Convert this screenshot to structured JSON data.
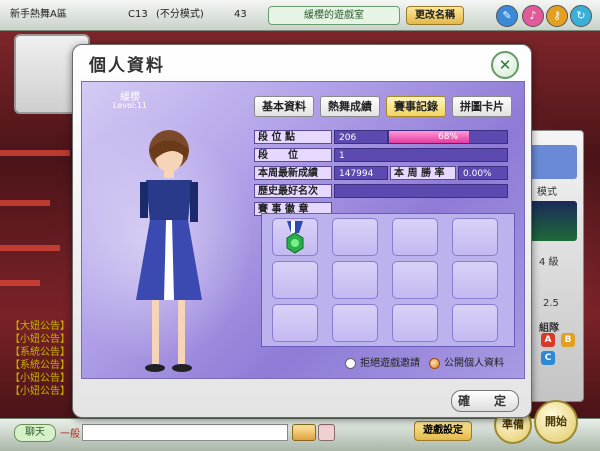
{
  "topbar": {
    "room_name": "新手熱舞A區",
    "room_number": "C13",
    "mode": "(不分模式)",
    "count": "43",
    "room_title": "緩櫻的遊戲室",
    "rename_label": "更改名稱"
  },
  "dialog": {
    "title": "個人資料",
    "character": {
      "name": "緩櫻",
      "level": "Level:11"
    },
    "tabs": [
      {
        "label": "基本資料",
        "active": false
      },
      {
        "label": "熱舞成績",
        "active": false
      },
      {
        "label": "賽事記錄",
        "active": true
      },
      {
        "label": "拼圖卡片",
        "active": false
      }
    ],
    "stats": {
      "rank_points_label": "段 位 點",
      "rank_points_value": "206",
      "rank_progress": 0.68,
      "rank_progress_label": "68%",
      "rank_label": "段　　位",
      "rank_value": "1",
      "weekly_best_label": "本周最新成績",
      "weekly_best_value": "147994",
      "weekly_win_rate_label": "本 周 勝 率",
      "weekly_win_rate_value": "0.00%",
      "best_rank_label": "歷史最好名次",
      "medals_label": "賽 事 徽 章"
    },
    "medal_slots": 12,
    "filled_medals": 1,
    "options": {
      "reject_invite_label": "拒絕遊戲邀請",
      "public_profile_label": "公開個人資料",
      "reject_invite_checked": false,
      "public_profile_checked": true
    },
    "ok_label": "確　定"
  },
  "bottombar": {
    "chat_label": "聊天",
    "chat_channel": "一般",
    "settings_label": "遊戲設定",
    "start_label": "開始",
    "ready_label": "準備"
  },
  "rightpanel": {
    "mode_label": "模式",
    "level_label": "4 級",
    "speed_value": "2.5",
    "team_label": "組隊",
    "team_buttons": [
      "A",
      "B",
      "C"
    ]
  }
}
